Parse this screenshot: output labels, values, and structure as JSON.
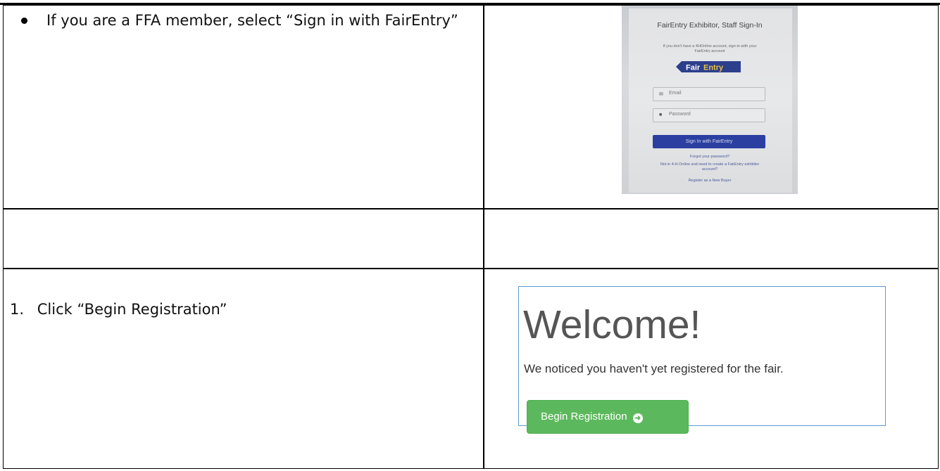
{
  "row1": {
    "instruction": "If you are a FFA member, select “Sign  in with FairEntry”"
  },
  "login_photo": {
    "title": "FairEntry Exhibitor, Staff Sign-In",
    "subtitle": "If you don't have a 4HOnline account, sign-in with your FairEntry account",
    "logo_text_fair": "Fair",
    "logo_text_entry": "Entry",
    "email_placeholder": "Email",
    "password_placeholder": "Password",
    "sign_in_button": "Sign In with FairEntry",
    "forgot_link": "Forgot your password?",
    "create_link": "Not in 4-H Online and need to create a FairEntry exhibitor account?",
    "buyer_link": "Register as a New Buyer",
    "button_color": "#2a3fa0"
  },
  "row3": {
    "step_number": "1.",
    "instruction": "Click “Begin Registration”"
  },
  "welcome_panel": {
    "heading": "Welcome!",
    "message": "We noticed you haven't yet registered for the fair.",
    "button_label": "Begin Registration",
    "button_icon": "arrow-circle-right-icon",
    "button_color": "#5cb85c",
    "border_color": "#5b9bd5"
  }
}
